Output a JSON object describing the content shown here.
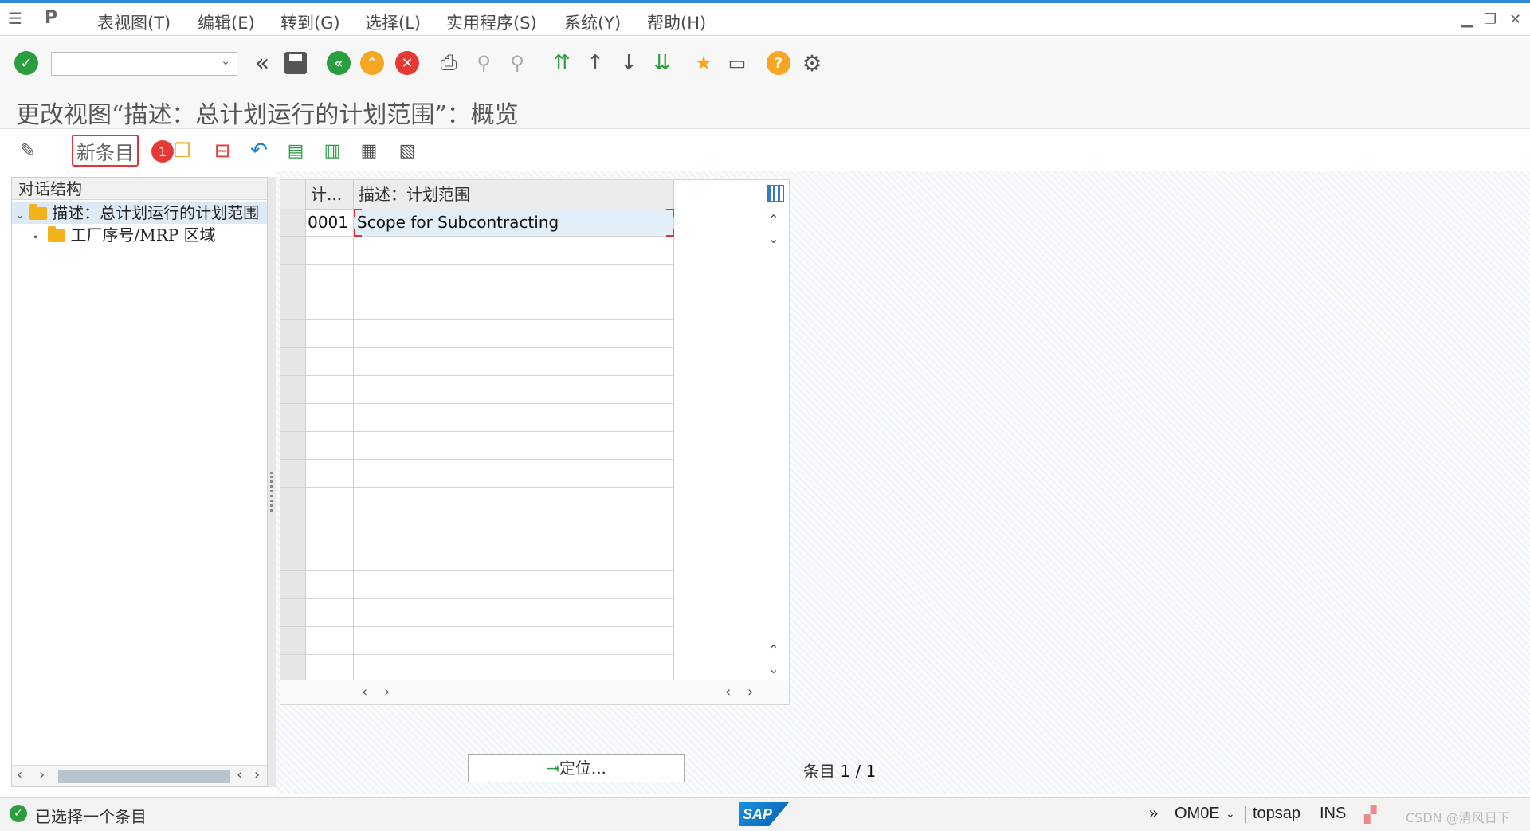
{
  "menu": {
    "items": [
      "表视图(T)",
      "编辑(E)",
      "转到(G)",
      "选择(L)",
      "实用程序(S)",
      "系统(Y)",
      "帮助(H)"
    ]
  },
  "toolbar": {
    "command_value": "",
    "icons": [
      "check-icon",
      "back-double-icon",
      "save-icon",
      "back-icon",
      "exit-icon",
      "cancel-icon",
      "print-icon",
      "find-icon",
      "find-next-icon",
      "first-page-icon",
      "prev-page-icon",
      "next-page-icon",
      "last-page-icon",
      "create-session-icon",
      "shortcut-icon",
      "help-icon",
      "settings-icon"
    ]
  },
  "title": "更改视图“描述：总计划运行的计划范围”：概览",
  "app_toolbar": {
    "new_entries": "新条目",
    "badge": "1"
  },
  "tree": {
    "header": "对话结构",
    "items": [
      {
        "label": "描述：总计划运行的计划范围",
        "selected": true
      },
      {
        "label": "工厂序号/MRP 区域",
        "selected": false
      }
    ]
  },
  "table": {
    "columns": [
      "计...",
      "描述：计划范围"
    ],
    "rows": [
      {
        "key": "0001",
        "desc": "Scope for Subcontracting"
      }
    ],
    "empty_rows": 16
  },
  "locate_button": "定位...",
  "entries": {
    "label": "条目",
    "value": "1 / 1"
  },
  "status": {
    "message": "已选择一个条目",
    "transaction": "OM0E",
    "system": "topsap",
    "mode": "INS",
    "watermark": "CSDN @清风日下"
  },
  "colors": {
    "accent": "#2f8bd5",
    "highlight": "#e0363b",
    "ok_green": "#2a9d3f",
    "warn_orange": "#f5a623",
    "cancel_red": "#e53935"
  }
}
